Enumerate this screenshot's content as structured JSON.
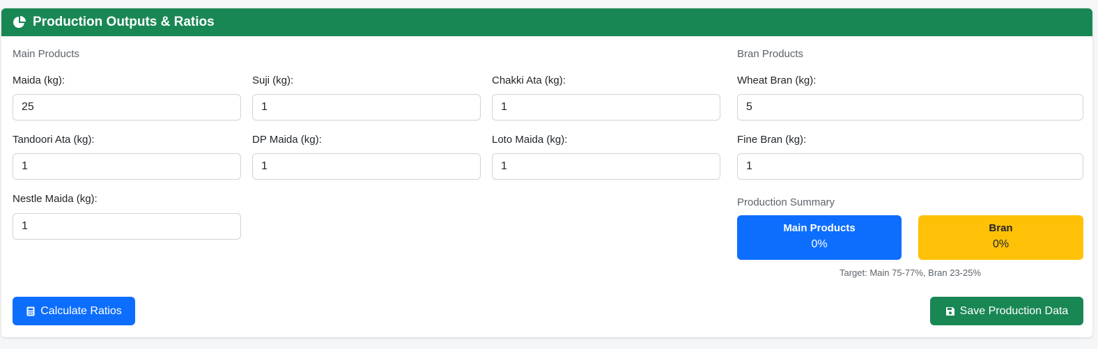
{
  "header": {
    "title": "Production Outputs & Ratios",
    "icon": "pie-chart-icon"
  },
  "main_products": {
    "label": "Main Products",
    "fields": {
      "maida": {
        "label": "Maida (kg):",
        "value": "25"
      },
      "suji": {
        "label": "Suji (kg):",
        "value": "1"
      },
      "chakki_ata": {
        "label": "Chakki Ata (kg):",
        "value": "1"
      },
      "tandoori_ata": {
        "label": "Tandoori Ata (kg):",
        "value": "1"
      },
      "dp_maida": {
        "label": "DP Maida (kg):",
        "value": "1"
      },
      "loto_maida": {
        "label": "Loto Maida (kg):",
        "value": "1"
      },
      "nestle_maida": {
        "label": "Nestle Maida (kg):",
        "value": "1"
      }
    }
  },
  "bran_products": {
    "label": "Bran Products",
    "fields": {
      "wheat_bran": {
        "label": "Wheat Bran (kg):",
        "value": "5"
      },
      "fine_bran": {
        "label": "Fine Bran (kg):",
        "value": "1"
      }
    }
  },
  "summary": {
    "label": "Production Summary",
    "main": {
      "title": "Main Products",
      "value": "0%",
      "color": "#0d6efd"
    },
    "bran": {
      "title": "Bran",
      "value": "0%",
      "color": "#ffc107"
    },
    "target": "Target: Main 75-77%, Bran 23-25%"
  },
  "actions": {
    "calculate": {
      "label": "Calculate Ratios",
      "icon": "calculator-icon",
      "color": "#0d6efd"
    },
    "save": {
      "label": "Save Production Data",
      "icon": "save-icon",
      "color": "#198754"
    }
  },
  "colors": {
    "header": "#198754"
  }
}
